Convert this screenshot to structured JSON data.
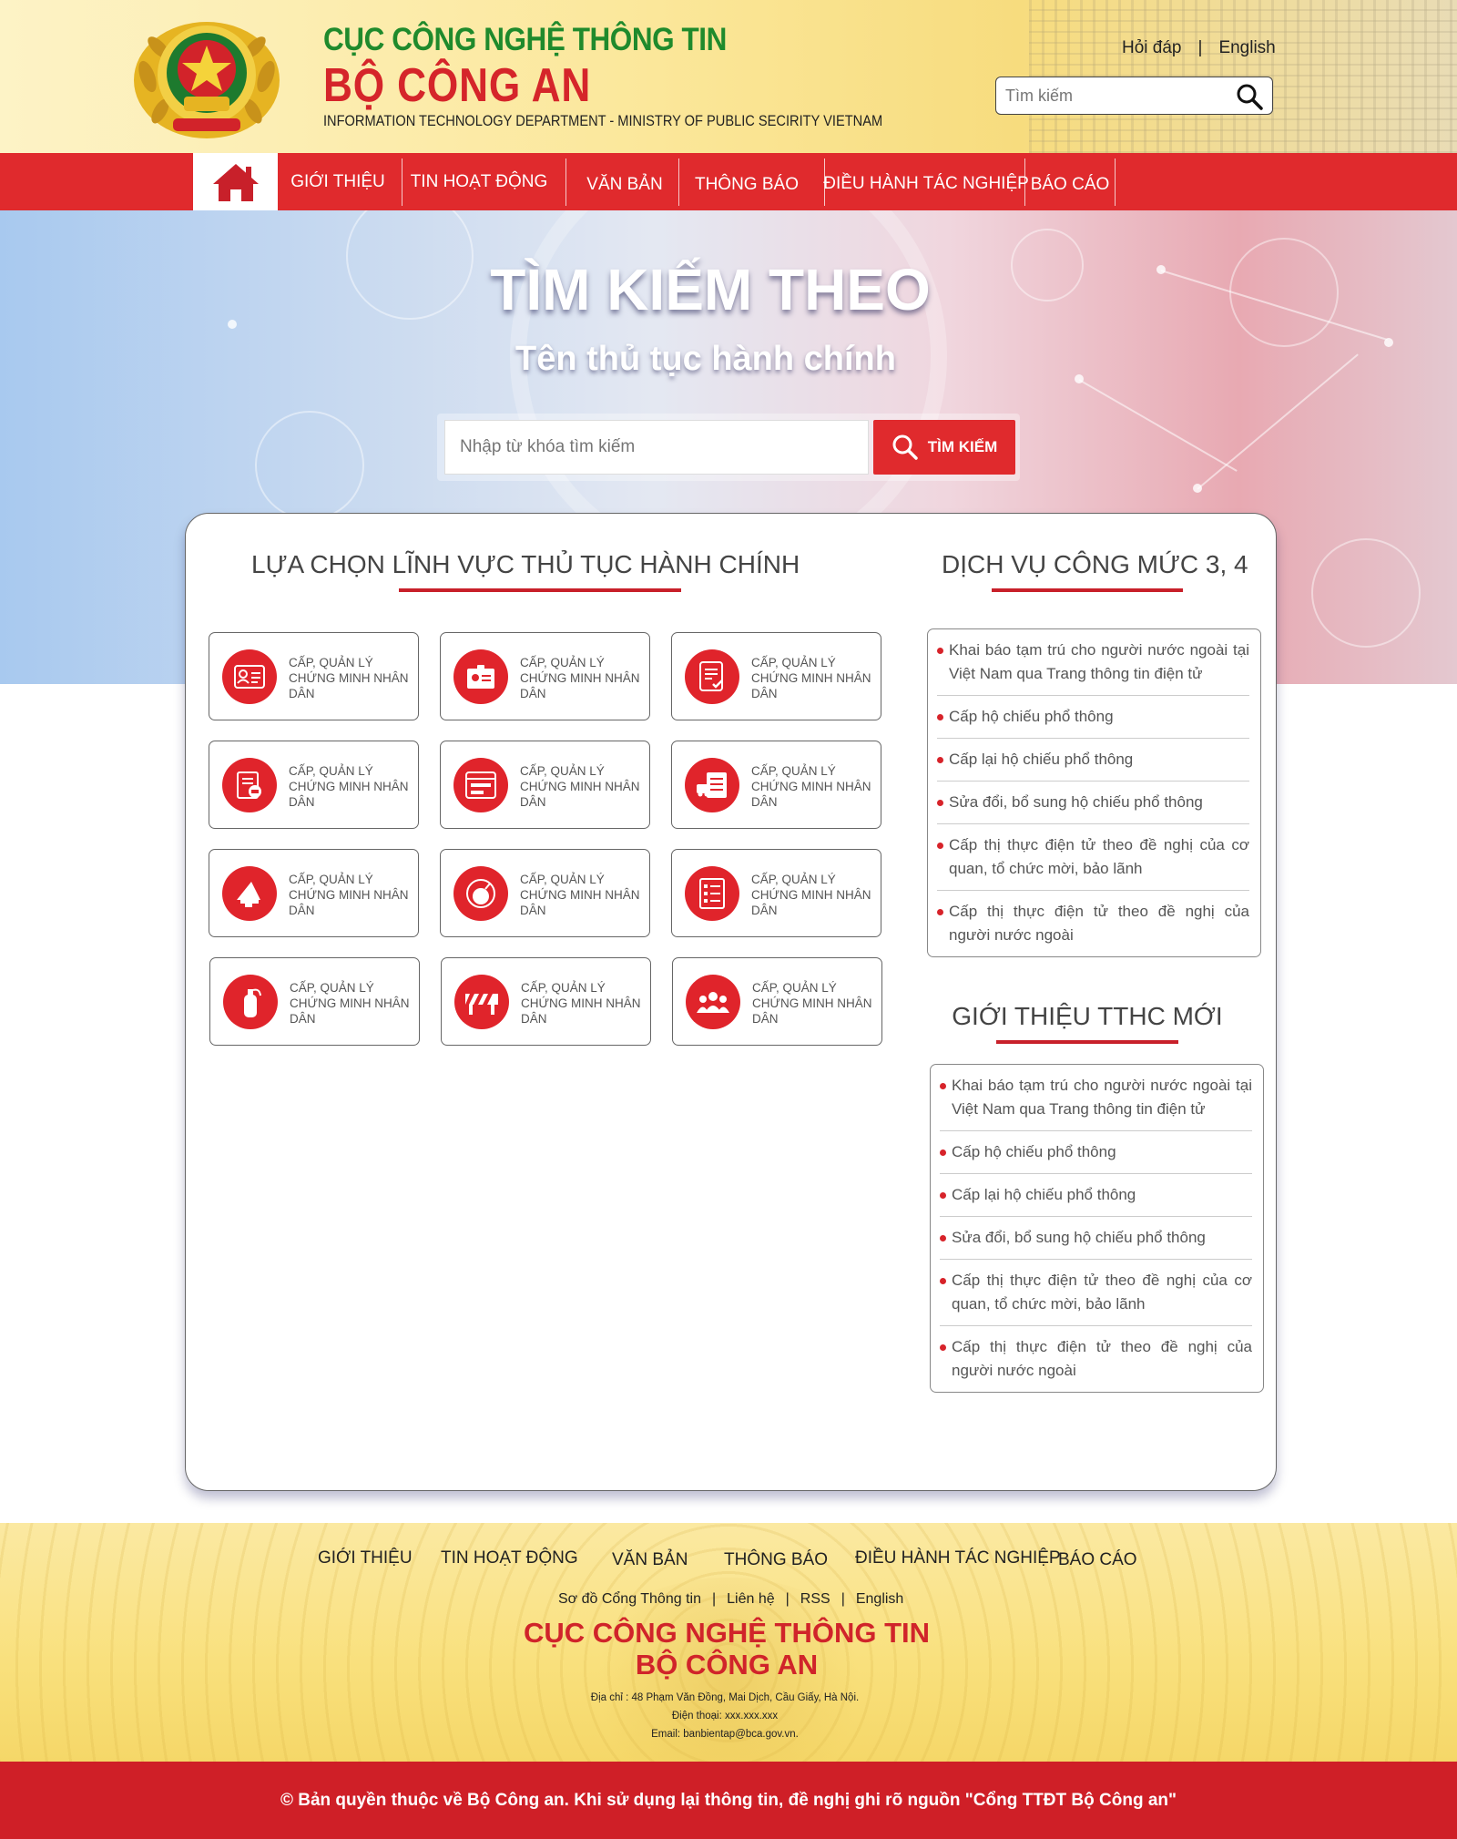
{
  "header": {
    "title_line1": "CỤC CÔNG NGHỆ THÔNG TIN",
    "title_line2": "BỘ CÔNG AN",
    "subtitle": "INFORMATION TECHNOLOGY DEPARTMENT - MINISTRY OF PUBLIC SECIRITY VIETNAM",
    "links": {
      "faq": "Hỏi đáp",
      "separator": "|",
      "english": "English"
    },
    "search_placeholder": "Tìm kiếm"
  },
  "nav": {
    "items": [
      "GIỚI THIỆU",
      "TIN HOẠT ĐỘNG",
      "VĂN BẢN",
      "THÔNG BÁO",
      "ĐIỀU HÀNH TÁC NGHIỆP",
      "BÁO CÁO"
    ]
  },
  "hero": {
    "title": "TÌM KIẾM THEO",
    "subtitle": "Tên thủ tục hành chính",
    "search_placeholder": "Nhập từ khóa tìm kiếm",
    "search_button": "TÌM KIẾM"
  },
  "categories": {
    "title": "LỰA CHỌN LĨNH VỰC THỦ TỤC HÀNH CHÍNH",
    "items": [
      {
        "label": "CẤP, QUẢN LÝ CHỨNG MINH NHÂN DÂN",
        "icon": "id-card-icon"
      },
      {
        "label": "CẤP, QUẢN LÝ CHỨNG MINH NHÂN DÂN",
        "icon": "badge-icon"
      },
      {
        "label": "CẤP, QUẢN LÝ CHỨNG MINH NHÂN DÂN",
        "icon": "document-check-icon"
      },
      {
        "label": "CẤP, QUẢN LÝ CHỨNG MINH NHÂN DÂN",
        "icon": "weapon-document-icon"
      },
      {
        "label": "CẤP, QUẢN LÝ CHỨNG MINH NHÂN DÂN",
        "icon": "browser-form-icon"
      },
      {
        "label": "CẤP, QUẢN LÝ CHỨNG MINH NHÂN DÂN",
        "icon": "vehicle-registration-icon"
      },
      {
        "label": "CẤP, QUẢN LÝ CHỨNG MINH NHÂN DÂN",
        "icon": "megaphone-icon"
      },
      {
        "label": "CẤP, QUẢN LÝ CHỨNG MINH NHÂN DÂN",
        "icon": "explosive-icon"
      },
      {
        "label": "CẤP, QUẢN LÝ CHỨNG MINH NHÂN DÂN",
        "icon": "checklist-icon"
      },
      {
        "label": "CẤP, QUẢN LÝ CHỨNG MINH NHÂN DÂN",
        "icon": "fire-extinguisher-icon"
      },
      {
        "label": "CẤP, QUẢN LÝ CHỨNG MINH NHÂN DÂN",
        "icon": "barrier-icon"
      },
      {
        "label": "CẤP, QUẢN LÝ CHỨNG MINH NHÂN DÂN",
        "icon": "people-group-icon"
      }
    ]
  },
  "services": {
    "title": "DỊCH VỤ CÔNG MỨC 3, 4",
    "items": [
      "Khai báo tạm trú cho người nước ngoài tại Việt Nam qua Trang thông tin điện tử",
      "Cấp hộ chiếu phổ thông",
      "Cấp lại hộ chiếu phổ thông",
      "Sửa đổi, bổ sung hộ chiếu phổ thông",
      "Cấp thị thực điện tử theo đề nghị của cơ quan, tổ chức mời, bảo lãnh",
      "Cấp thị thực điện tử theo đề nghị của người nước ngoài"
    ]
  },
  "new_procedures": {
    "title": "GIỚI THIỆU TTHC MỚI",
    "items": [
      "Khai báo tạm trú cho người nước ngoài tại Việt Nam qua Trang thông tin điện tử",
      "Cấp hộ chiếu phổ thông",
      "Cấp lại hộ chiếu phổ thông",
      "Sửa đổi, bổ sung hộ chiếu phổ thông",
      "Cấp thị thực điện tử theo đề nghị của cơ quan, tổ chức mời, bảo lãnh",
      "Cấp thị thực điện tử theo đề nghị của người nước ngoài"
    ]
  },
  "footer": {
    "nav": [
      "GIỚI THIỆU",
      "TIN HOẠT ĐỘNG",
      "VĂN BẢN",
      "THÔNG BÁO",
      "ĐIỀU HÀNH TÁC NGHIỆP",
      "BÁO CÁO"
    ],
    "links": [
      "Sơ đồ Cổng Thông tin",
      "Liên hệ",
      "RSS",
      "English"
    ],
    "separator": "|",
    "title_line1": "CỤC CÔNG NGHỆ THÔNG TIN",
    "title_line2": "BỘ CÔNG AN",
    "address": "Địa chỉ : 48 Phạm Văn Đồng, Mai Dịch, Cầu Giấy, Hà Nội.",
    "phone": "Điện thoại: xxx.xxx.xxx",
    "email": "Email: banbientap@bca.gov.vn.",
    "copyright": "© Bản quyền thuộc về Bộ Công an. Khi sử dụng lại thông tin, đề nghị ghi rõ nguồn \"Cổng TTĐT Bộ Công an\""
  },
  "colors": {
    "primary_red": "#e02a2d",
    "brand_green": "#1f8a2c",
    "footer_red": "#cf1f27"
  }
}
